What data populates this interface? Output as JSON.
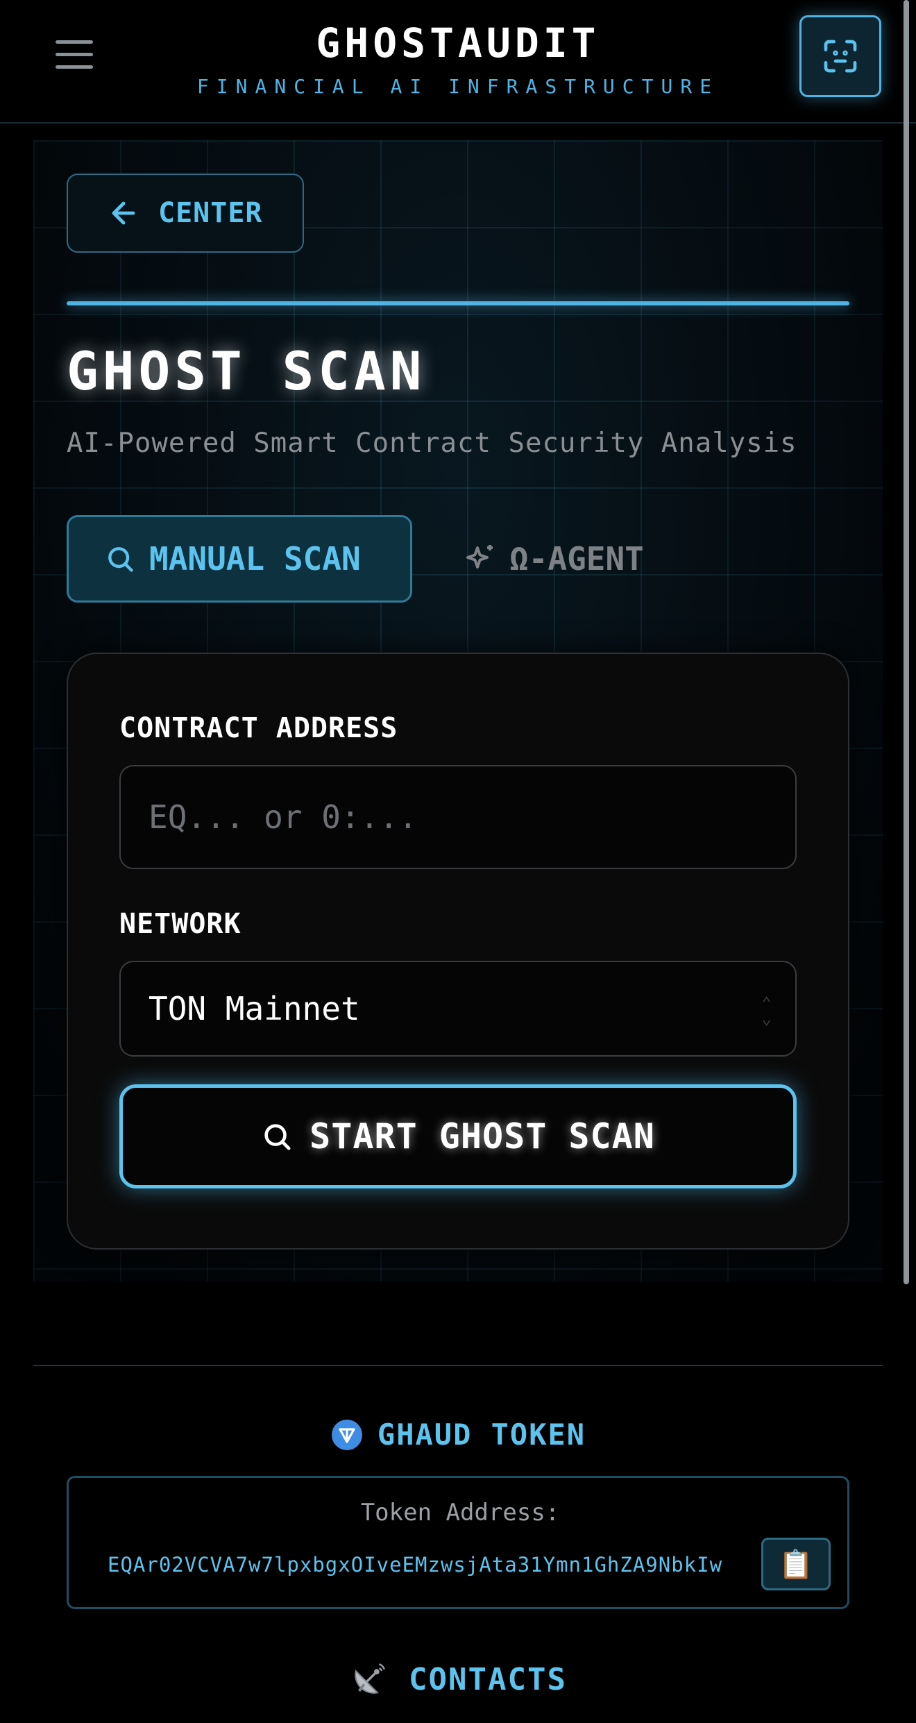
{
  "header": {
    "title": "GHOSTAUDIT",
    "subtitle": "FINANCIAL AI INFRASTRUCTURE",
    "menu_icon": "hamburger-icon",
    "scan_icon": "scan-frame-icon"
  },
  "nav": {
    "back_label": "CENTER",
    "back_icon": "arrow-left-icon"
  },
  "main": {
    "title": "GHOST SCAN",
    "subtitle": "AI-Powered Smart Contract Security Analysis",
    "tabs": [
      {
        "label": "MANUAL SCAN",
        "icon": "search-icon",
        "active": true
      },
      {
        "label": "Ω-AGENT",
        "icon": "sparkle-icon",
        "active": false
      }
    ]
  },
  "form": {
    "contract_label": "CONTRACT ADDRESS",
    "contract_placeholder": "EQ... or 0:...",
    "contract_value": "",
    "network_label": "NETWORK",
    "network_value": "TON Mainnet",
    "submit_label": "START GHOST SCAN",
    "submit_icon": "search-icon"
  },
  "footer": {
    "token_heading": "GHAUD TOKEN",
    "token_icon": "ton-logo-icon",
    "token_caption": "Token Address:",
    "token_address": "EQAr02VCVA7w7lpxbgxOIveEMzwsjAta31Ymn1GhZA9NbkIw",
    "copy_icon": "clipboard-icon",
    "contacts_heading": "CONTACTS",
    "contacts_icon": "satellite-dish-icon"
  },
  "colors": {
    "accent": "#4fb3e3",
    "accent_text": "#5cc3ef",
    "background": "#000000",
    "muted": "#8a8f93"
  }
}
